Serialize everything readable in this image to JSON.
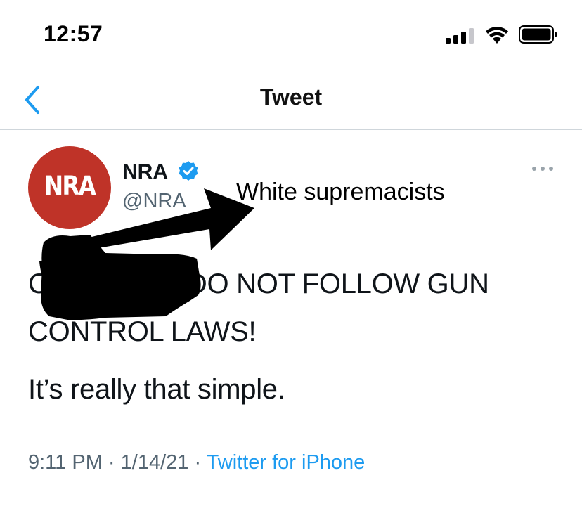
{
  "status_bar": {
    "time": "12:57"
  },
  "nav": {
    "title": "Tweet"
  },
  "author": {
    "avatar_text": "NRA",
    "display_name": "NRA",
    "handle": "@NRA"
  },
  "annotation": {
    "text": "White supremacists"
  },
  "tweet": {
    "line1": "CRIMINALS DO NOT FOLLOW GUN",
    "line2": "CONTROL LAWS!",
    "line3": "It’s really that simple."
  },
  "meta": {
    "time": "9:11 PM",
    "sep1": " · ",
    "date": "1/14/21",
    "sep2": " · ",
    "source": "Twitter for iPhone"
  },
  "colors": {
    "accent": "#1d9bf0",
    "avatar_bg": "#bf3328",
    "muted_text": "#536471"
  }
}
